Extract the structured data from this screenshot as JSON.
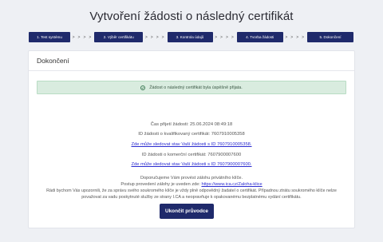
{
  "page": {
    "title": "Vytvoření žádosti o následný certifikát"
  },
  "steps": [
    {
      "label": "1. Test systému"
    },
    {
      "label": "2. Výběr certifikátu"
    },
    {
      "label": "3. Kontrola údajů"
    },
    {
      "label": "4. Tvorba žádosti"
    },
    {
      "label": "5. Dokončení"
    }
  ],
  "step_separator": "> > > >",
  "card": {
    "header": "Dokončení",
    "alert": "Žádost o následný certifikát byla úspěšně přijata.",
    "received_time": "Čas přijetí žádosti: 25.06.2024 08:49:18",
    "qualified_id": "ID žádosti o kvalifikovaný certifikát: 7607910005358",
    "qualified_link": "Zde může sledovat stav Vaší žádosti s ID 7607910005358.",
    "commercial_id": "ID žádosti o komerční certifikát: 7607900007600",
    "commercial_link": "Zde může sledovat stav Vaší žádosti s ID 7607900007600.",
    "recommend_line": "Doporučujeme Vám provést zálohu privátního klíče.",
    "backup_prefix": "Postup provedení zálohy je uveden zde: ",
    "backup_link": "https://www.ica.cz/Zaloha-klice",
    "warning": "Rádi bychom Vás upozornili, že za správu svého soukromého klíče je vždy plně odpovědný žadatel o certifikát. Případnou ztrátu soukromého klíče nelze považovat za vadu poskytnuté služby ze strany I.CA a neopravňuje k opakovanému bezplatnému vydání certifikátu.",
    "finish_button": "Ukončit průvodce"
  },
  "colors": {
    "navy": "#1f2a6b",
    "success_bg": "#d9ecdf",
    "link": "#2b2bd0"
  }
}
